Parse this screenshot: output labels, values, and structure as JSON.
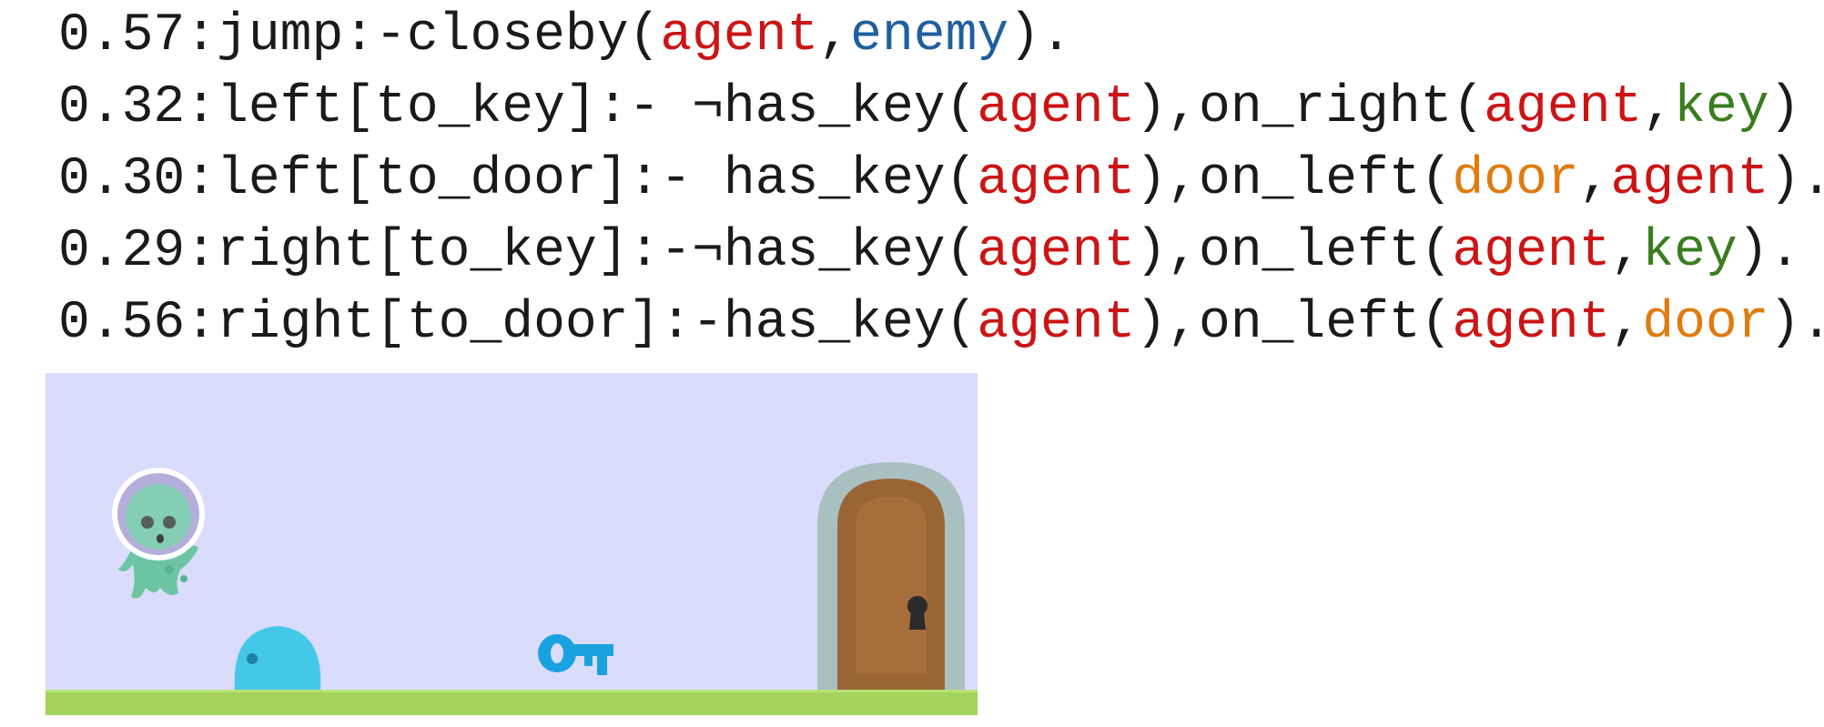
{
  "colors": {
    "text": "#1a1a1a",
    "agent": "#cc1414",
    "enemy": "#1f5f9e",
    "key": "#3a7d1e",
    "door": "#e07b10",
    "background": "#dadcfb",
    "ground": "#a3d35d"
  },
  "rules": [
    {
      "tokens": [
        {
          "text": "0.57:jump:-closeby(",
          "kind": "text"
        },
        {
          "text": "agent",
          "kind": "agent"
        },
        {
          "text": ",",
          "kind": "text"
        },
        {
          "text": "enemy",
          "kind": "enemy"
        },
        {
          "text": ").",
          "kind": "text"
        }
      ]
    },
    {
      "tokens": [
        {
          "text": "0.32:left[to_key]:- ¬has_key(",
          "kind": "text"
        },
        {
          "text": "agent",
          "kind": "agent"
        },
        {
          "text": "),on_right(",
          "kind": "text"
        },
        {
          "text": "agent",
          "kind": "agent"
        },
        {
          "text": ",",
          "kind": "text"
        },
        {
          "text": "key",
          "kind": "key"
        },
        {
          "text": ")",
          "kind": "text"
        }
      ]
    },
    {
      "tokens": [
        {
          "text": "0.30:left[to_door]:- has_key(",
          "kind": "text"
        },
        {
          "text": "agent",
          "kind": "agent"
        },
        {
          "text": "),on_left(",
          "kind": "text"
        },
        {
          "text": "door",
          "kind": "door"
        },
        {
          "text": ",",
          "kind": "text"
        },
        {
          "text": "agent",
          "kind": "agent"
        },
        {
          "text": ").",
          "kind": "text"
        }
      ]
    },
    {
      "tokens": [
        {
          "text": "0.29:right[to_key]:-¬has_key(",
          "kind": "text"
        },
        {
          "text": "agent",
          "kind": "agent"
        },
        {
          "text": "),on_left(",
          "kind": "text"
        },
        {
          "text": "agent",
          "kind": "agent"
        },
        {
          "text": ",",
          "kind": "text"
        },
        {
          "text": "key",
          "kind": "key"
        },
        {
          "text": ").",
          "kind": "text"
        }
      ]
    },
    {
      "tokens": [
        {
          "text": "0.56:right[to_door]:-has_key(",
          "kind": "text"
        },
        {
          "text": "agent",
          "kind": "agent"
        },
        {
          "text": "),on_left(",
          "kind": "text"
        },
        {
          "text": "agent",
          "kind": "agent"
        },
        {
          "text": ",",
          "kind": "text"
        },
        {
          "text": "door",
          "kind": "door"
        },
        {
          "text": ").",
          "kind": "text"
        }
      ]
    }
  ],
  "scene": {
    "sprites": [
      {
        "name": "agent-alien-icon",
        "icon": "alien-astronaut"
      },
      {
        "name": "enemy-slime-icon",
        "icon": "blue-slime"
      },
      {
        "name": "key-icon",
        "icon": "blue-key"
      },
      {
        "name": "door-icon",
        "icon": "wooden-door"
      }
    ]
  }
}
